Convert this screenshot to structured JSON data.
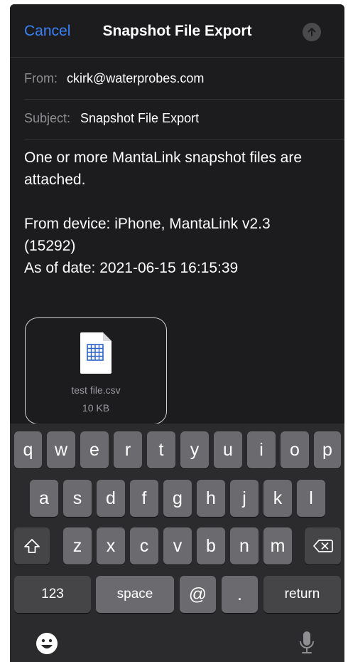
{
  "header": {
    "cancel_label": "Cancel",
    "title": "Snapshot File Export"
  },
  "fields": {
    "from_label": "From:",
    "from_value": "ckirk@waterprobes.com",
    "subject_label": "Subject:",
    "subject_value": "Snapshot File Export"
  },
  "body": {
    "paragraph1": "One or more MantaLink snapshot files are attached.",
    "line_device": "From device: iPhone, MantaLink v2.3 (15292)",
    "line_date": "As of date: 2021-06-15 16:15:39"
  },
  "attachment": {
    "file_name": "test file.csv",
    "file_size": "10 KB",
    "icon": "spreadsheet-file-icon"
  },
  "keyboard": {
    "row1": [
      "q",
      "w",
      "e",
      "r",
      "t",
      "y",
      "u",
      "i",
      "o",
      "p"
    ],
    "row2": [
      "a",
      "s",
      "d",
      "f",
      "g",
      "h",
      "j",
      "k",
      "l"
    ],
    "row3": [
      "z",
      "x",
      "c",
      "v",
      "b",
      "n",
      "m"
    ],
    "numbers_label": "123",
    "space_label": "space",
    "at_label": "@",
    "period_label": ".",
    "return_label": "return",
    "shift_icon": "shift-icon",
    "delete_icon": "delete-icon",
    "emoji_icon": "emoji-icon",
    "dictation_icon": "microphone-icon"
  },
  "colors": {
    "accent": "#3b82f6",
    "background": "#1c1c1e",
    "key": "#6b6b6f",
    "key_dark": "#454548"
  }
}
